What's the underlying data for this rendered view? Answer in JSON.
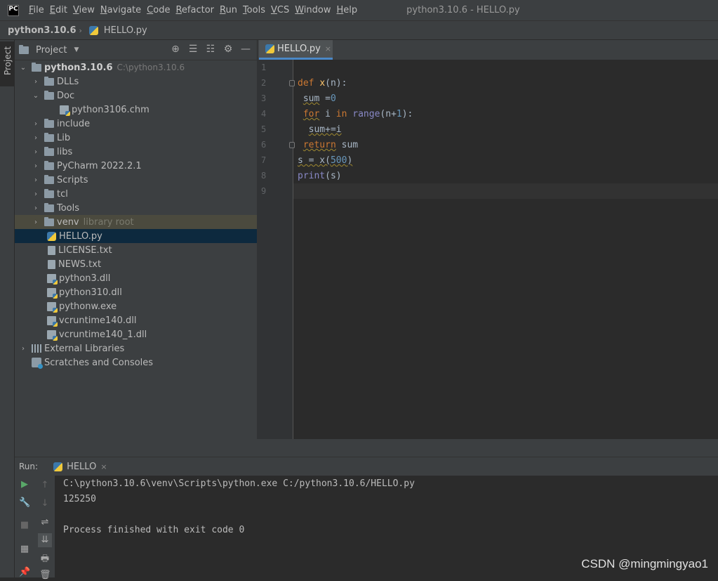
{
  "menubar": {
    "logo": "PC",
    "items": [
      {
        "u": "F",
        "rest": "ile"
      },
      {
        "u": "E",
        "rest": "dit"
      },
      {
        "u": "V",
        "rest": "iew"
      },
      {
        "u": "N",
        "rest": "avigate"
      },
      {
        "u": "C",
        "rest": "ode"
      },
      {
        "u": "R",
        "rest": "efactor"
      },
      {
        "u": "R",
        "rest": "un"
      },
      {
        "u": "T",
        "rest": "ools"
      },
      {
        "u": "V",
        "rest": "CS"
      },
      {
        "u": "W",
        "rest": "indow"
      },
      {
        "u": "H",
        "rest": "elp"
      }
    ],
    "title": "python3.10.6 - HELLO.py"
  },
  "breadcrumb": {
    "root": "python3.10.6",
    "sep": "›",
    "file": "HELLO.py"
  },
  "side_tab": "Project",
  "project_panel": {
    "title": "Project",
    "dropdown": "▼",
    "icons": [
      "⊕",
      "☰",
      "☷",
      "⚙",
      "—"
    ],
    "tree": [
      {
        "label": "python3.10.6",
        "extra": "C:\\python3.10.6",
        "type": "folder",
        "arrow": "⌄",
        "bold": true
      },
      {
        "label": "DLLs",
        "type": "folder",
        "arrow": "›"
      },
      {
        "label": "Doc",
        "type": "folder",
        "arrow": "⌄"
      },
      {
        "label": "python3106.chm",
        "type": "dll"
      },
      {
        "label": "include",
        "type": "folder",
        "arrow": "›"
      },
      {
        "label": "Lib",
        "type": "folder",
        "arrow": "›"
      },
      {
        "label": "libs",
        "type": "folder",
        "arrow": "›"
      },
      {
        "label": "PyCharm 2022.2.1",
        "type": "folder",
        "arrow": "›"
      },
      {
        "label": "Scripts",
        "type": "folder",
        "arrow": "›"
      },
      {
        "label": "tcl",
        "type": "folder",
        "arrow": "›"
      },
      {
        "label": "Tools",
        "type": "folder",
        "arrow": "›"
      },
      {
        "label": "venv",
        "extra": "library root",
        "type": "folder",
        "arrow": "›"
      },
      {
        "label": "HELLO.py",
        "type": "py"
      },
      {
        "label": "LICENSE.txt",
        "type": "file"
      },
      {
        "label": "NEWS.txt",
        "type": "file"
      },
      {
        "label": "python3.dll",
        "type": "dll"
      },
      {
        "label": "python310.dll",
        "type": "dll"
      },
      {
        "label": "pythonw.exe",
        "type": "dll"
      },
      {
        "label": "vcruntime140.dll",
        "type": "dll"
      },
      {
        "label": "vcruntime140_1.dll",
        "type": "dll"
      },
      {
        "label": "External Libraries",
        "type": "lib",
        "arrow": "›"
      },
      {
        "label": "Scratches and Consoles",
        "type": "scratch"
      }
    ]
  },
  "editor": {
    "tab_label": "HELLO.py",
    "tab_close": "×",
    "line_numbers": [
      "1",
      "2",
      "3",
      "4",
      "5",
      "6",
      "7",
      "8",
      "9"
    ],
    "lines": [
      "",
      "def x(n):",
      " sum =0",
      " for i in range(n+1):",
      "  sum+=i",
      " return sum",
      "s = x(500)",
      "print(s)",
      ""
    ]
  },
  "run": {
    "label": "Run:",
    "tab_label": "HELLO",
    "tab_close": "×",
    "tools_left": [
      "▶",
      "🔧",
      "■",
      "▦",
      "📌"
    ],
    "tools_right": [
      "↑",
      "↓",
      "⇌",
      "⇊",
      "🖶",
      "🗑"
    ],
    "output": [
      "C:\\python3.10.6\\venv\\Scripts\\python.exe C:/python3.10.6/HELLO.py",
      "125250",
      "",
      "Process finished with exit code 0"
    ]
  },
  "watermark": "CSDN @mingmingyao1"
}
